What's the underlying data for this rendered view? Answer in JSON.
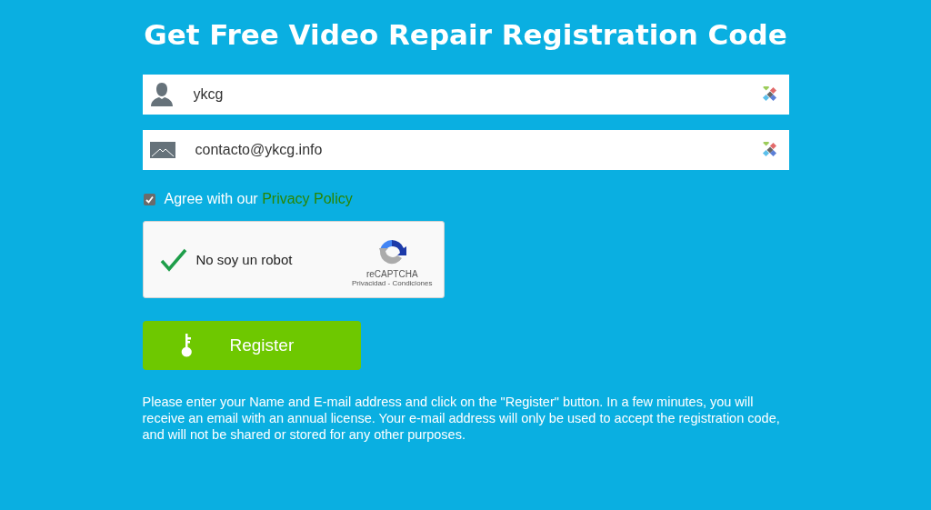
{
  "title": "Get Free Video Repair Registration Code",
  "fields": [
    {
      "kind": "name",
      "value": "ykcg"
    },
    {
      "kind": "email",
      "value": "contacto@ykcg.info"
    }
  ],
  "agree": {
    "checked": true,
    "text": "Agree with our",
    "link": "Privacy Policy"
  },
  "captcha": {
    "checked": true,
    "label": "No soy un robot",
    "brand": "reCAPTCHA",
    "links": [
      "Privacidad",
      "Condiciones"
    ],
    "separator": "-"
  },
  "register_button": "Register",
  "note": "Please enter your Name and E-mail address and click on the \"Register\" button. In a few minutes, you will receive an email with an annual license. Your e-mail address will only be used to accept the registration code, and will not be shared or stored for any other purposes."
}
